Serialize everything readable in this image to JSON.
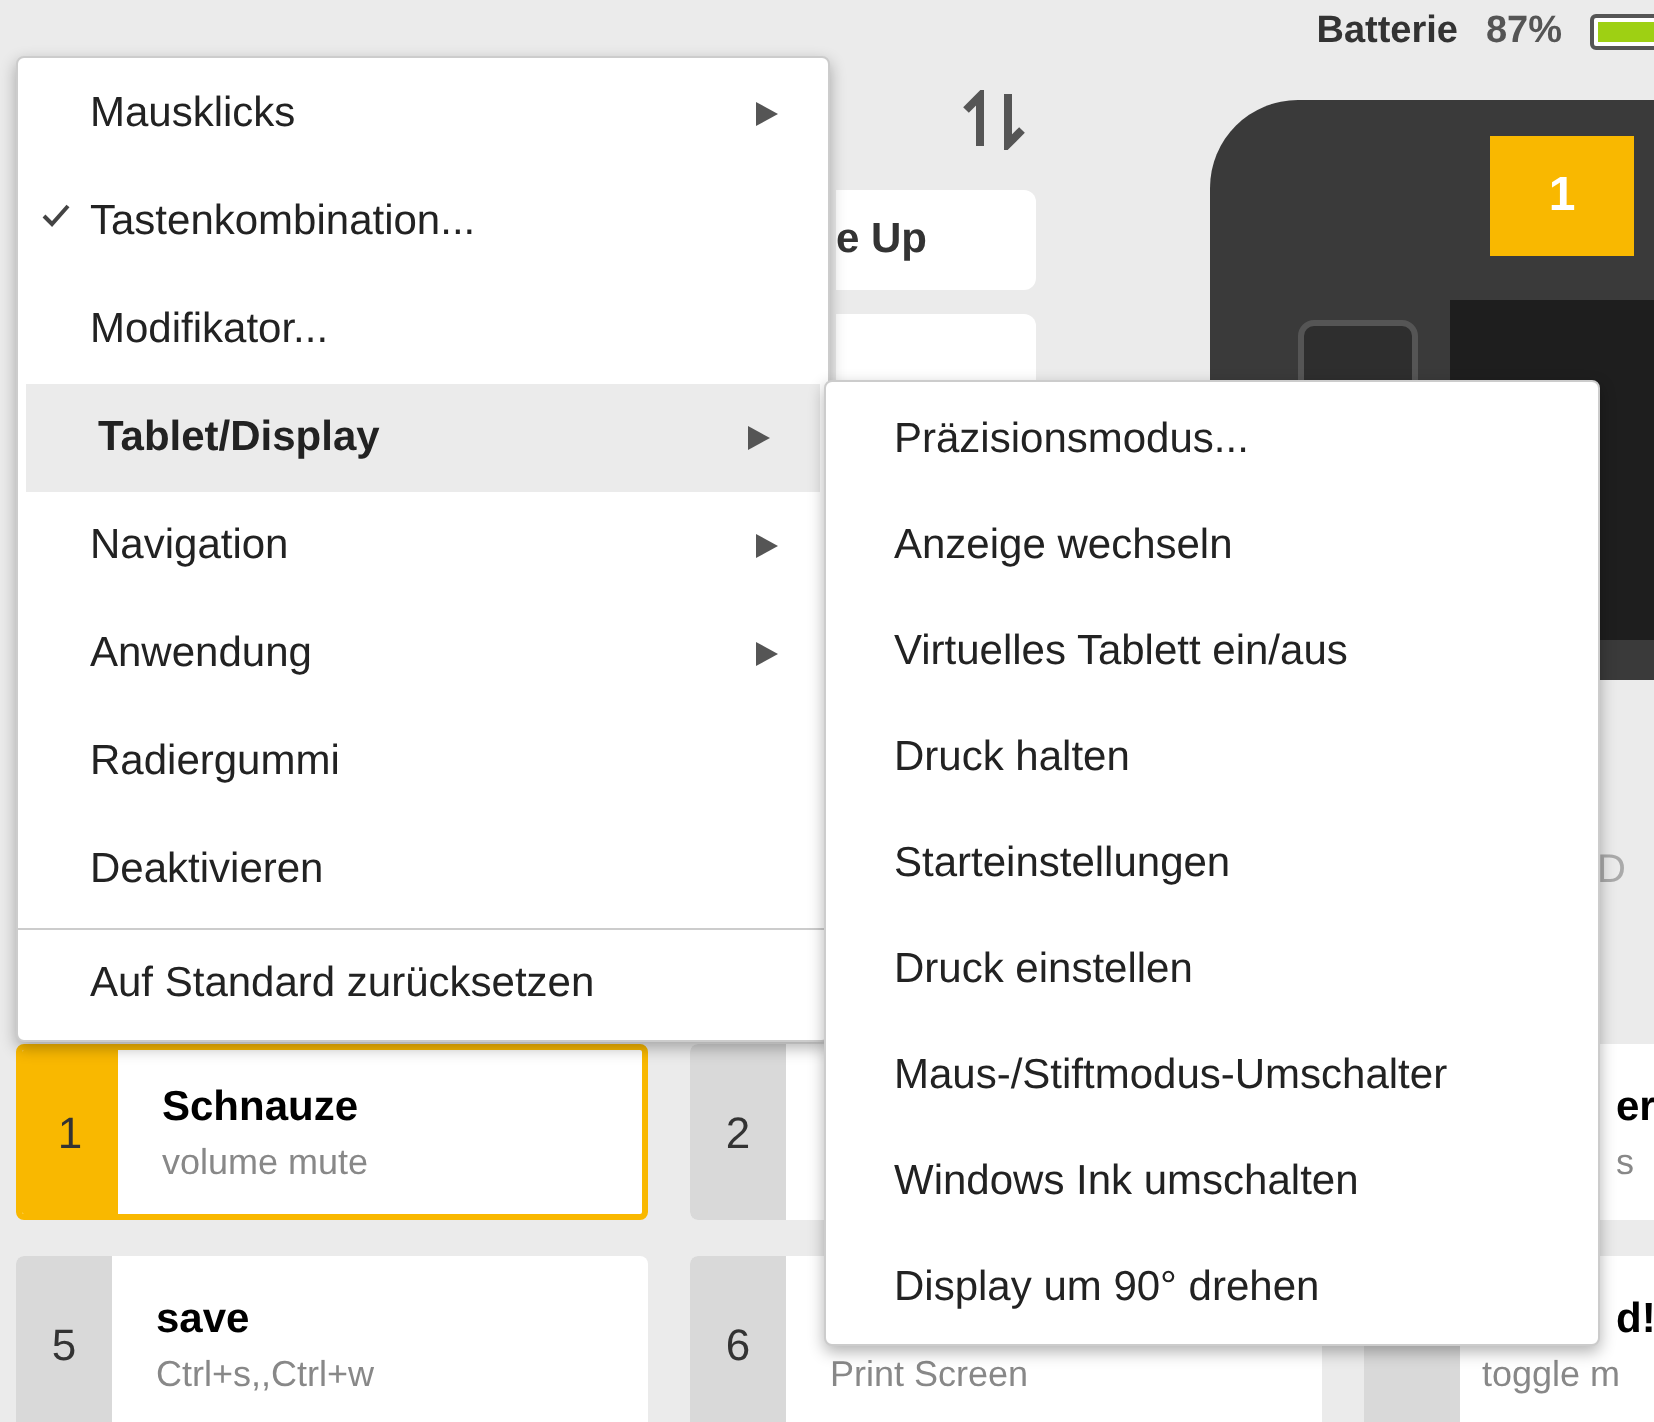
{
  "header": {
    "battery_label": "Batterie",
    "battery_percent": "87%"
  },
  "actions_column": {
    "cards": [
      "e Up"
    ]
  },
  "device": {
    "keys": [
      {
        "label": "1",
        "selected": true
      }
    ],
    "side_label": "D"
  },
  "context_menu": {
    "items": [
      {
        "label": "Mausklicks",
        "checked": false,
        "has_submenu": true,
        "selected": false
      },
      {
        "label": "Tastenkombination...",
        "checked": true,
        "has_submenu": false,
        "selected": false
      },
      {
        "label": "Modifikator...",
        "checked": false,
        "has_submenu": false,
        "selected": false
      },
      {
        "label": "Tablet/Display",
        "checked": false,
        "has_submenu": true,
        "selected": true
      },
      {
        "label": "Navigation",
        "checked": false,
        "has_submenu": true,
        "selected": false
      },
      {
        "label": "Anwendung",
        "checked": false,
        "has_submenu": true,
        "selected": false
      },
      {
        "label": "Radiergummi",
        "checked": false,
        "has_submenu": false,
        "selected": false
      },
      {
        "label": "Deaktivieren",
        "checked": false,
        "has_submenu": false,
        "selected": false
      }
    ],
    "reset": "Auf Standard zurücksetzen"
  },
  "submenu": {
    "items": [
      "Präzisionsmodus...",
      "Anzeige wechseln",
      "Virtuelles Tablett ein/aus",
      "Druck halten",
      "Starteinstellungen",
      "Druck einstellen",
      "Maus-/Stiftmodus-Umschalter",
      "Windows Ink umschalten",
      "Display um 90° drehen"
    ]
  },
  "buttons": [
    {
      "number": "1",
      "title": "Schnauze",
      "subtitle": "volume mute",
      "selected": true
    },
    {
      "number": "2",
      "selected": false
    },
    {
      "title": "er",
      "subtitle": "s",
      "selected": false
    },
    {
      "number": "5",
      "title": "save",
      "subtitle": "Ctrl+s,,Ctrl+w",
      "selected": false
    },
    {
      "number": "6",
      "subtitle": "Print Screen",
      "selected": false
    },
    {
      "title": "d!",
      "subtitle": "toggle m",
      "selected": false
    }
  ]
}
